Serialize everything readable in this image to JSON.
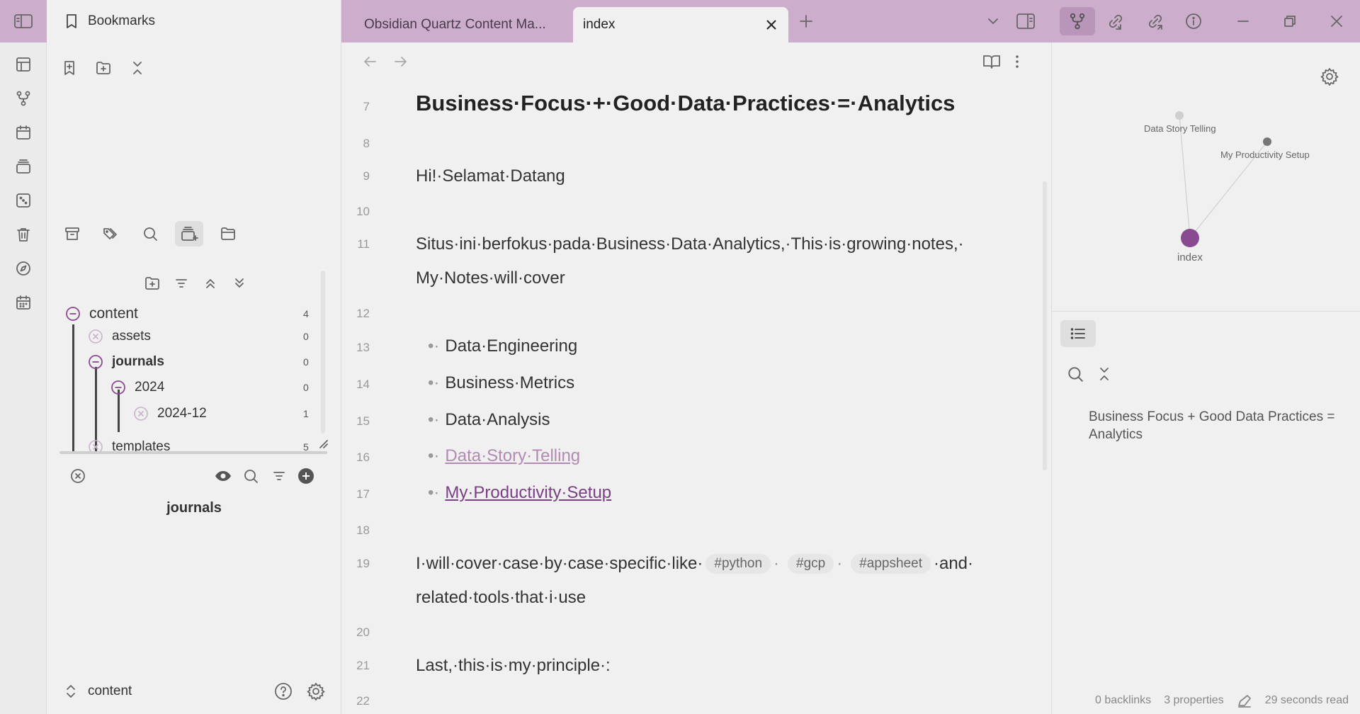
{
  "left_sidebar": {
    "header_title": "Bookmarks",
    "tree": {
      "items": [
        {
          "label": "content",
          "count": "4"
        },
        {
          "label": "assets",
          "count": "0"
        },
        {
          "label": "journals",
          "count": "0"
        },
        {
          "label": "2024",
          "count": "0"
        },
        {
          "label": "2024-12",
          "count": "1"
        },
        {
          "label": "templates",
          "count": "5"
        }
      ]
    },
    "tag_panel_title": "journals",
    "vault_name": "content"
  },
  "tabs": [
    {
      "label": "Obsidian Quartz Content Ma..."
    },
    {
      "label": "index"
    }
  ],
  "editor": {
    "lines": [
      {
        "no": "7",
        "text": "Business·Focus·+·Good·Data·Practices·=·Analytics"
      },
      {
        "no": "8",
        "text": ""
      },
      {
        "no": "9",
        "text": "Hi!·Selamat·Datang"
      },
      {
        "no": "10",
        "text": ""
      },
      {
        "no": "11",
        "text": "Situs·ini·berfokus·pada·Business·Data·Analytics,·This·is·growing·notes,·",
        "wrap": "My·Notes·will·cover"
      },
      {
        "no": "12",
        "text": ""
      },
      {
        "no": "13",
        "text": "Data·Engineering"
      },
      {
        "no": "14",
        "text": "Business·Metrics"
      },
      {
        "no": "15",
        "text": "Data·Analysis"
      },
      {
        "no": "16",
        "text": "Data·Story·Telling"
      },
      {
        "no": "17",
        "text": "My·Productivity·Setup"
      },
      {
        "no": "18",
        "text": ""
      },
      {
        "no": "19",
        "text_a": "I·will·cover·case·by·case·specific·like·",
        "tags": [
          "#python",
          "#gcp",
          "#appsheet"
        ],
        "text_b": "·and·",
        "wrap": "related·tools·that·i·use"
      },
      {
        "no": "20",
        "text": ""
      },
      {
        "no": "21",
        "text": "Last,·this·is·my·principle·:"
      },
      {
        "no": "22",
        "text": ""
      }
    ],
    "bullet_symbol": "•·",
    "tag_separator": "·"
  },
  "graph": {
    "nodes": [
      {
        "label": "Data Story Telling"
      },
      {
        "label": "My Productivity Setup"
      },
      {
        "label": "index"
      }
    ]
  },
  "outline": {
    "heading": "Business Focus + Good Data Practices = Analytics"
  },
  "status_bar": {
    "backlinks": "0 backlinks",
    "properties": "3 properties",
    "read_time": "29 seconds read"
  },
  "colors": {
    "accent": "#7a3f85",
    "titlebar": "#ccaecc"
  }
}
